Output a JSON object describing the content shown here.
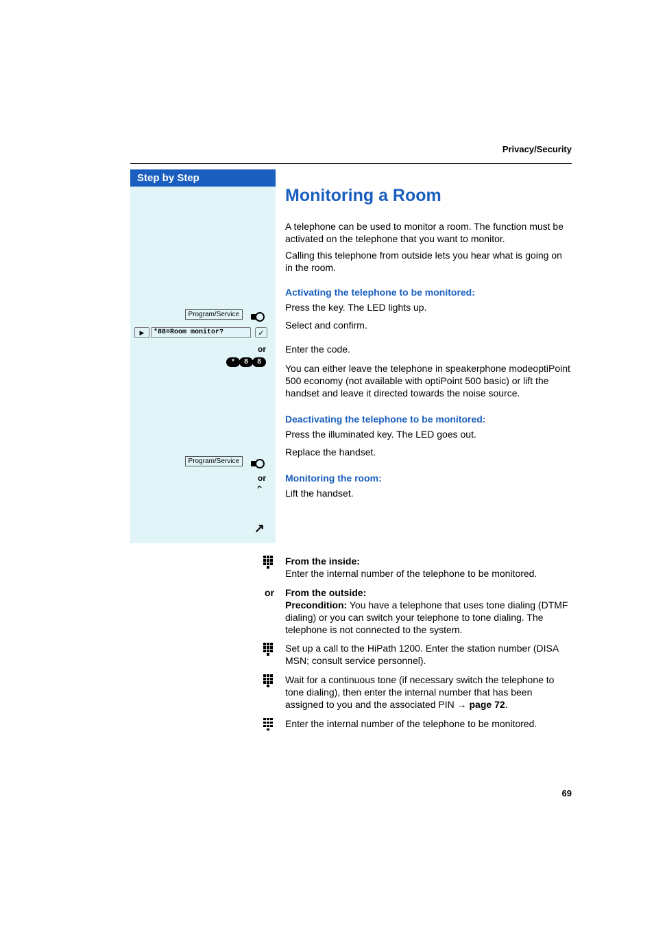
{
  "header": {
    "breadcrumb": "Privacy/Security"
  },
  "sidebar": {
    "title": "Step by Step",
    "items": [
      {
        "kind": "key",
        "label": "Program/Service"
      },
      {
        "kind": "lcd",
        "text": "*88=Room monitor?"
      },
      {
        "kind": "or",
        "label": "or"
      },
      {
        "kind": "digits",
        "keys": [
          "*",
          "8",
          "8"
        ]
      },
      {
        "kind": "gap1"
      },
      {
        "kind": "key",
        "label": "Program/Service"
      },
      {
        "kind": "or",
        "label": "or"
      },
      {
        "kind": "handset_down"
      },
      {
        "kind": "gap2"
      },
      {
        "kind": "handset_up"
      }
    ]
  },
  "main": {
    "title": "Monitoring a Room",
    "intro1": "A telephone can be used to monitor a room. The function must be activated on the telephone that you want to monitor.",
    "intro2": "Calling this telephone from outside lets you hear what is going on in the room.",
    "sect1_head": "Activating the telephone to be monitored:",
    "sect1_step1": "Press the key. The LED lights up.",
    "sect1_step2": "Select and confirm.",
    "sect1_step3": "Enter the code.",
    "sect1_note": "You can either leave the telephone in speakerphone modeoptiPoint 500 economy (not available with optiPoint 500 basic) or lift the handset and leave it directed towards the noise source.",
    "sect2_head": "Deactivating the telephone to be monitored:",
    "sect2_step1": "Press the illuminated key. The LED goes out.",
    "sect2_step2": "Replace the handset.",
    "sect3_head": "Monitoring the room:",
    "sect3_step1": "Lift the handset."
  },
  "lower": {
    "rows": [
      {
        "icon": "keypad",
        "label_strong": "From the inside:",
        "text": "Enter the internal number of the telephone to be monitored."
      },
      {
        "icon": "or",
        "or_text": "or",
        "label_strong": "From the outside:",
        "pre_strong": "Precondition:",
        "text": " You have a telephone that uses tone dialing (DTMF dialing) or you can switch your telephone to tone dialing. The telephone is not connected to the system."
      },
      {
        "icon": "keypad",
        "text": "Set up a call to the HiPath 1200. Enter the station number (DISA MSN; consult service personnel)."
      },
      {
        "icon": "keypad",
        "text": "Wait for a continuous tone (if necessary switch the telephone to tone dialing), then enter the internal number that has been assigned to you and the associated PIN ",
        "link": "→ page 72",
        "suffix": "."
      },
      {
        "icon": "keypad",
        "text": "Enter the internal number of the telephone to be monitored."
      }
    ]
  },
  "page_number": "69"
}
